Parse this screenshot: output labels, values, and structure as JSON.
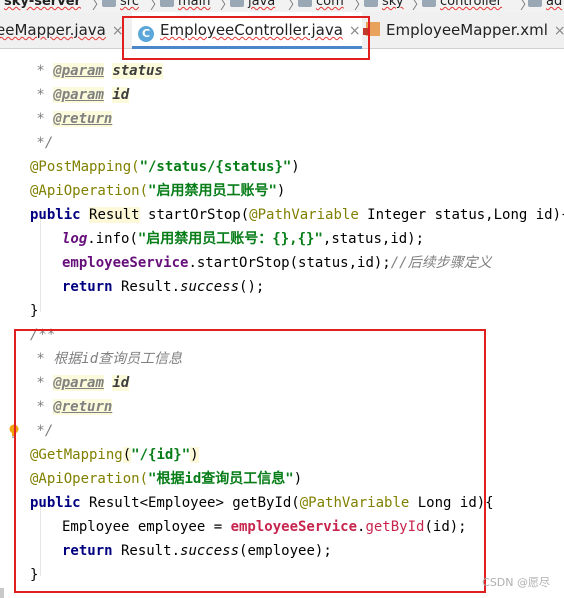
{
  "breadcrumb": {
    "items": [
      "sky-server",
      "src",
      "main",
      "java",
      "com",
      "sky",
      "controller",
      "ad"
    ],
    "separator": "〉"
  },
  "tabs": [
    {
      "label": "eeMapper.java",
      "close": "×",
      "icon": "interface-icon"
    },
    {
      "label": "EmployeeController.java",
      "close": "×",
      "icon": "class-c-icon",
      "icon_letter": "C",
      "active": true
    },
    {
      "label": "EmployeeMapper.xml",
      "close": "×",
      "icon": "xml-file-icon"
    }
  ],
  "code": {
    "l1_star": " * ",
    "l1_tag": "@param",
    "l1_val": "status",
    "l2_star": " * ",
    "l2_tag": "@param",
    "l2_val": "id",
    "l3_star": " * ",
    "l3_tag": "@return",
    "l4": " */",
    "l5_ann": "@PostMapping(",
    "l5_str": "\"/status/{status}\"",
    "l5_end": ")",
    "l6_ann": "@ApiOperation(",
    "l6_str": "\"启用禁用员工账号\"",
    "l6_end": ")",
    "l7_kw": "public",
    "l7_type": "Result",
    "l7_mid": " startOrStop(",
    "l7_ann": "@PathVariable",
    "l7_rest": " Integer status,Long id){",
    "l8_log": "log",
    "l8_a": ".info(",
    "l8_str": "\"启用禁用员工账号：{},{}\"",
    "l8_b": ",status,id);",
    "l9_fld": "employeeService",
    "l9_a": ".startOrStop(status,id);",
    "l9_cm": "//后续步骤定义",
    "l10_kw": "return",
    "l10_a": " Result.",
    "l10_m": "success",
    "l10_b": "();",
    "l11": "}",
    "l12": "/**",
    "l13": " * 根据id查询员工信息",
    "l14_star": " * ",
    "l14_tag": "@param",
    "l14_val": "id",
    "l15_star": " * ",
    "l15_tag": "@return",
    "l16": " */",
    "l17_ann": "@GetMapping",
    "l17_p1": "(",
    "l17_str": "\"/{id}\"",
    "l17_p2": ")",
    "l18_ann": "@ApiOperation(",
    "l18_str": "\"根据id查询员工信息\"",
    "l18_end": ")",
    "l19_kw": "public",
    "l19_a": " Result<Employee> getById(",
    "l19_ann": "@PathVariable",
    "l19_b": " Long id){",
    "l20_a": "Employee employee = ",
    "l20_fld": "employeeService",
    "l20_dot": ".",
    "l20_m": "getById",
    "l20_b": "(id);",
    "l21_kw": "return",
    "l21_a": " Result.",
    "l21_m": "success",
    "l21_b": "(employee);",
    "l22": "}"
  },
  "watermark": "CSDN @愿尽",
  "colors": {
    "annotation_box": "#e02020",
    "tab_underline": "#4a86c8"
  }
}
